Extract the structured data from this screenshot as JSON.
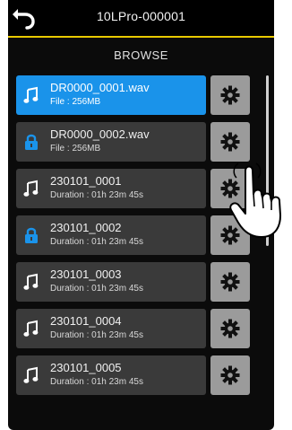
{
  "header": {
    "device_name": "10LPro-000001",
    "back_icon": "back-arrow-icon"
  },
  "screen_title": "BROWSE",
  "colors": {
    "accent_line": "#e8c900",
    "selected_row": "#1a93ea",
    "row_bg": "#3a3a3a",
    "settings_bg": "#9b9b9b"
  },
  "items": [
    {
      "name": "DR0000_0001.wav",
      "detail": "File : 256MB",
      "icon": "music-note-icon",
      "selected": true
    },
    {
      "name": "DR0000_0002.wav",
      "detail": "File : 256MB",
      "icon": "lock-icon",
      "selected": false
    },
    {
      "name": "230101_0001",
      "detail": "Duration : 01h 23m 45s",
      "icon": "music-note-icon",
      "selected": false
    },
    {
      "name": "230101_0002",
      "detail": "Duration : 01h 23m 45s",
      "icon": "lock-icon",
      "selected": false
    },
    {
      "name": "230101_0003",
      "detail": "Duration : 01h 23m 45s",
      "icon": "music-note-icon",
      "selected": false
    },
    {
      "name": "230101_0004",
      "detail": "Duration : 01h 23m 45s",
      "icon": "music-note-icon",
      "selected": false
    },
    {
      "name": "230101_0005",
      "detail": "Duration : 01h 23m 45s",
      "icon": "music-note-icon",
      "selected": false
    }
  ],
  "settings_icon": "gear-icon",
  "pointer_icon": "hand-pointer-icon"
}
